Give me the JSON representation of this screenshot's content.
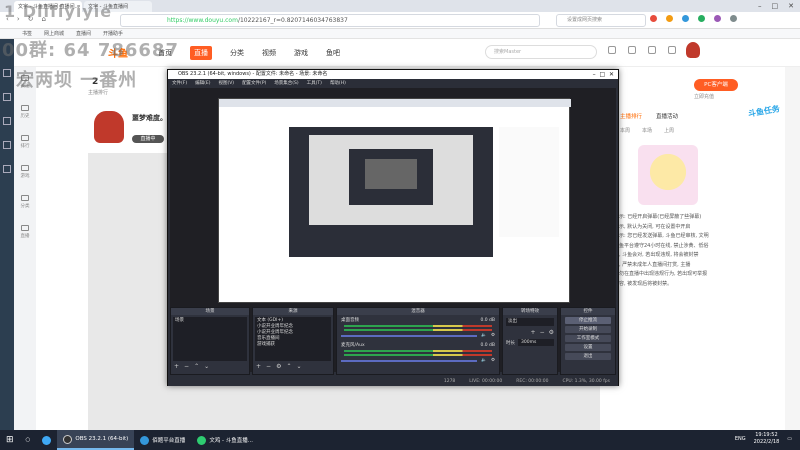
{
  "browser": {
    "tabs": [
      "文字 - 斗鱼直播间 直播间...",
      "文字 - 斗鱼直播间"
    ],
    "url_host": "https://www.douyu.com",
    "url_path": "/10222167_r=0.8207146034763837",
    "search_hint": "设置成网页搜索",
    "bookmarks": [
      "书签",
      "网上商城",
      "直播间",
      "开播助手"
    ]
  },
  "douyu": {
    "logo": "斗鱼",
    "nav": [
      "首页",
      "直播",
      "分类",
      "视频",
      "游戏",
      "鱼吧"
    ],
    "search_placeholder": "搜索Master",
    "left_icons": [
      "关注",
      "历史",
      "排行",
      "游戏",
      "分类",
      "直播"
    ],
    "streamer_name": "噩梦难度。",
    "streamer_tag": "直播中",
    "rank": "2",
    "rank_label": "主播排行",
    "right_tabs": [
      "主播排行",
      "直播活动"
    ],
    "right_sub": [
      "本周",
      "本场",
      "上周"
    ],
    "promo_text": "斗鱼任务",
    "chat_lines": [
      "系统提示: 已经开启弹幕(已经屏蔽了些弹幕)",
      "以上提示, 默认为关闭, 可在设置中开启",
      "系统提示: 您已经发送弹幕, 斗鱼已经审核, 文明",
      "请在斗鱼平台遵守24小时在线, 禁止涉黄、低俗",
      "等内容, 斗鱼会对, 若出现违规, 将会被封禁",
      "直播间, 严禁未成年人直播间打赏, 主播",
      "注意请勿在直播中出现违规行为, 若出现可举报",
      "低俗内容, 被发现后将被封禁。"
    ],
    "pc_btn": "PC客户端",
    "recharge": "立即充值"
  },
  "obs": {
    "title": "OBS 23.2.1 (64-bit, windows) - 配置文件: 未命名 - 场景: 未命名",
    "menu": [
      "文件(F)",
      "编辑(E)",
      "视图(V)",
      "配置文件(P)",
      "场景集合(S)",
      "工具(T)",
      "帮助(H)"
    ],
    "docks": {
      "scenes": "场景",
      "sources": "来源",
      "mixer": "混音器",
      "transitions": "转场特效",
      "controls": "控件"
    },
    "scene_items": [
      "场景"
    ],
    "source_items": [
      "文本 (GDI+)",
      "小说开业周年纪念",
      "小说开业周年纪念",
      "音乐直播间",
      "游戏捕获"
    ],
    "mixer_items": [
      {
        "name": "桌面音频",
        "db": "0.0 dB"
      },
      {
        "name": "麦克风/Aux",
        "db": "0.0 dB"
      }
    ],
    "transition_name": "淡出",
    "duration_label": "时长",
    "duration_value": "300ms",
    "control_buttons": [
      "停止推流",
      "开始录制",
      "工作室模式",
      "设置",
      "退出"
    ],
    "status": {
      "live": "LIVE: 00:00:00",
      "rec": "REC: 00:00:00",
      "cpu": "CPU: 1.3%, 30.00 fps",
      "frames": "1278"
    }
  },
  "overlay": {
    "line1": "1 Dlifiyiyie",
    "line2": "00群: 64 786687",
    "line3": "宏两坝 一番州"
  },
  "taskbar": {
    "items": [
      "OBS 23.2.1 (64-bit)",
      "佰题平台直播",
      "文鸡 - 斗鱼直播..."
    ],
    "time": "19:19:52",
    "date": "2022/2/18",
    "lang": "ENG"
  },
  "colors": {
    "accent": "#ff5d23",
    "obs_bg": "#2b2e38",
    "taskbar": "#1c2331"
  }
}
